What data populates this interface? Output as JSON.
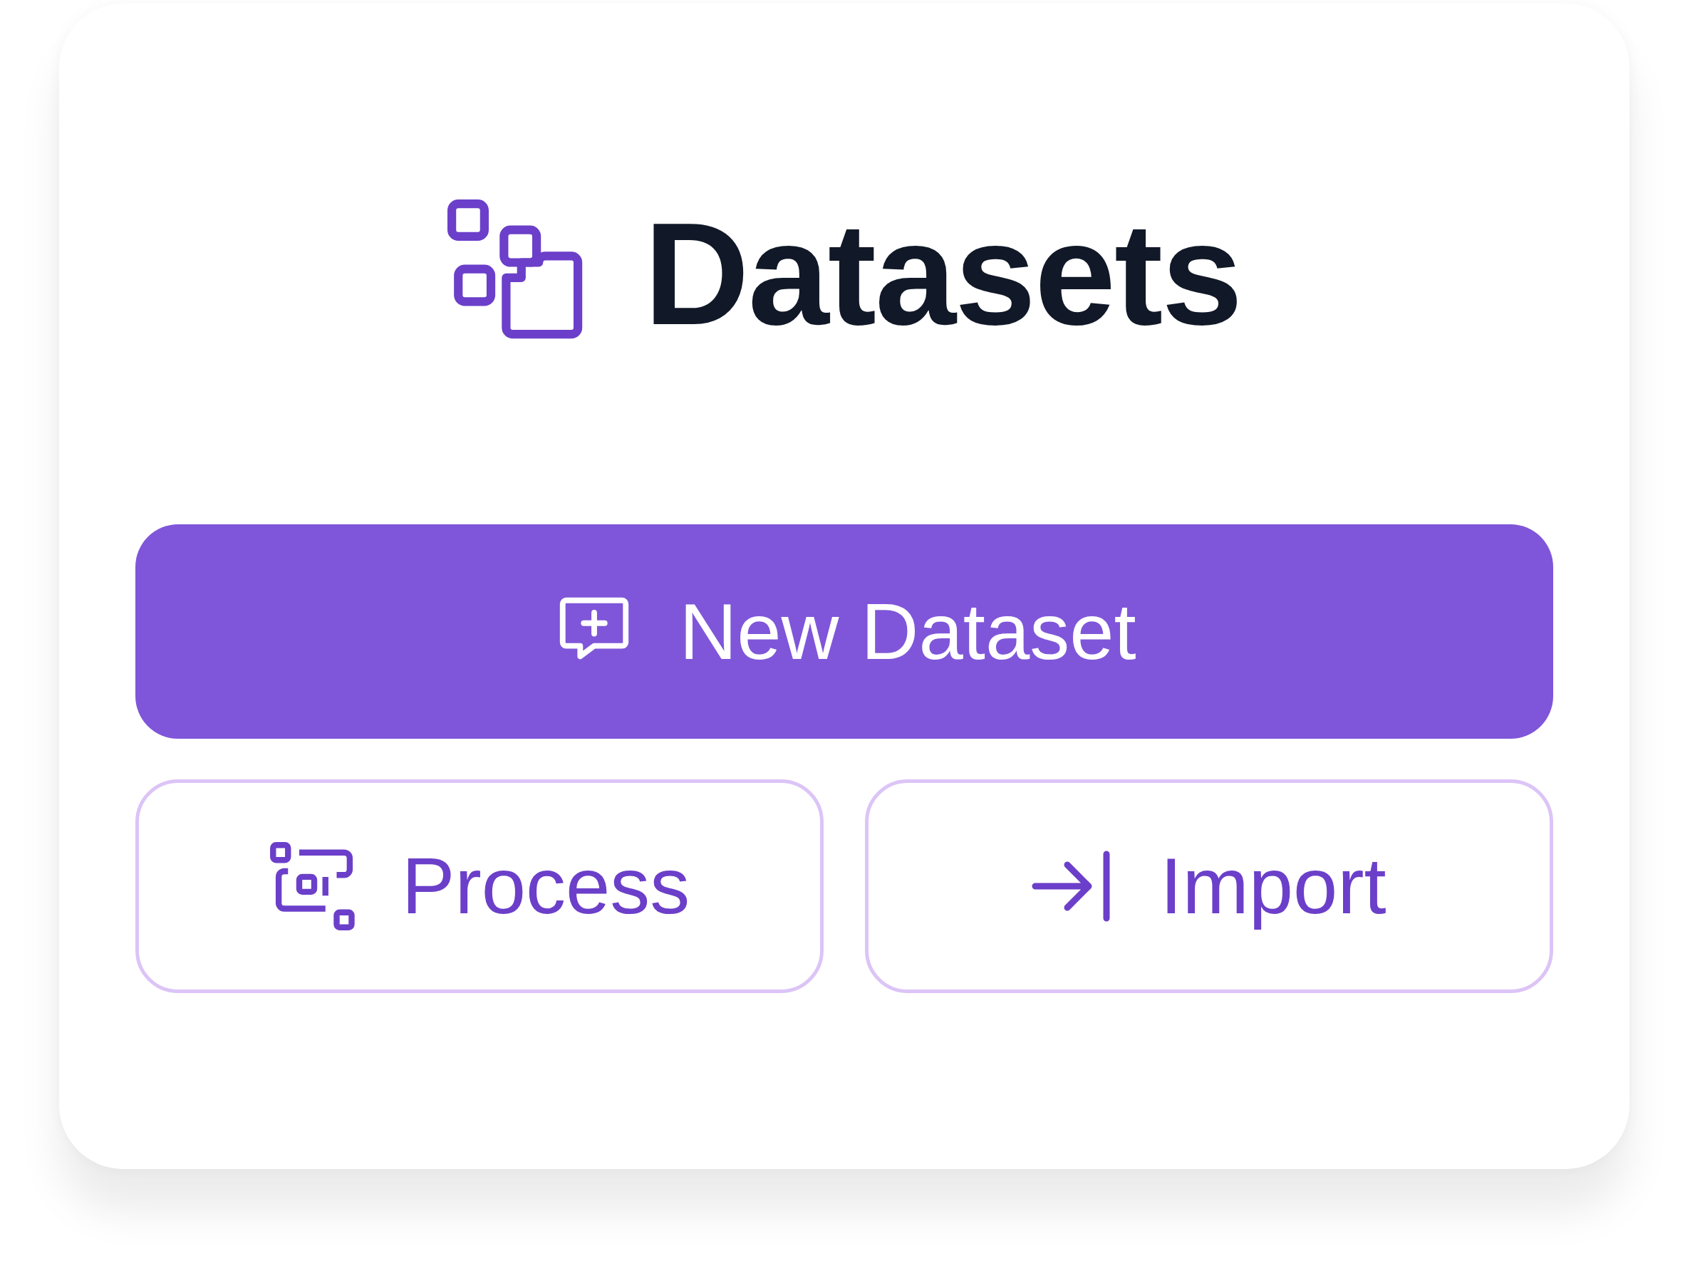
{
  "title": "Datasets",
  "primary_button": {
    "label": "New Dataset"
  },
  "buttons": [
    {
      "kind": "process",
      "label": "Process"
    },
    {
      "kind": "import",
      "label": "Import"
    }
  ]
}
